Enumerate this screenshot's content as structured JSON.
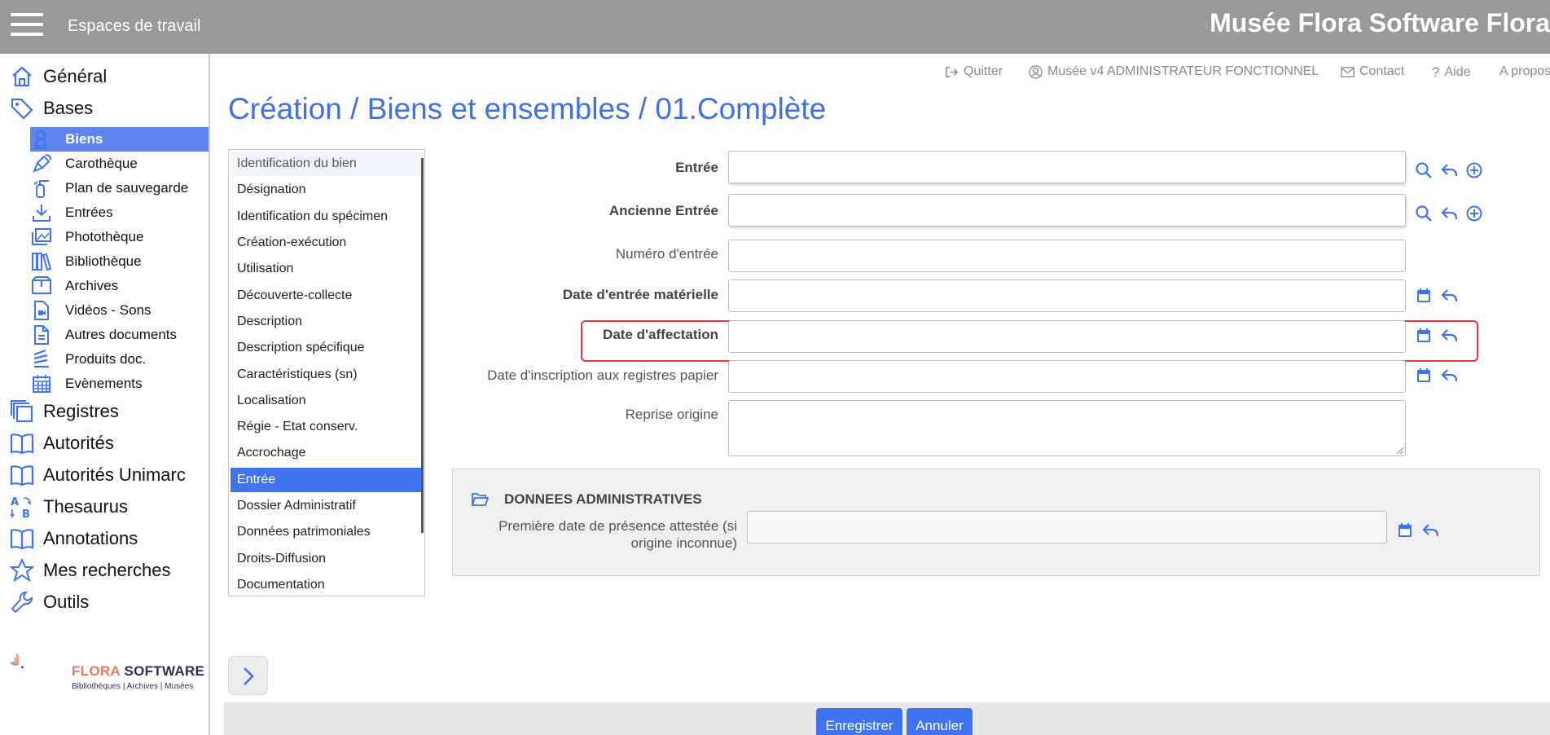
{
  "header": {
    "menu_icon": "hamburger-icon",
    "workspace_label": "Espaces de travail",
    "app_title": "Musée Flora Software Flora"
  },
  "utility_links": [
    {
      "icon": "logout-icon",
      "label": "Quitter"
    },
    {
      "icon": "user-icon",
      "label": "Musée v4 ADMINISTRATEUR FONCTIONNEL"
    },
    {
      "icon": "mail-icon",
      "label": "Contact"
    },
    {
      "icon": "question-icon",
      "label": "Aide"
    },
    {
      "icon": "",
      "label": "A propos"
    }
  ],
  "sidebar": {
    "top_general": {
      "label": "Général",
      "icon": "home-icon"
    },
    "top_bases": {
      "label": "Bases",
      "icon": "tag-icon"
    },
    "bases_items": [
      {
        "label": "Biens",
        "icon": "statue-icon",
        "active": true
      },
      {
        "label": "Carothèque",
        "icon": "pen-icon"
      },
      {
        "label": "Plan de sauvegarde",
        "icon": "extinguisher-icon"
      },
      {
        "label": "Entrées",
        "icon": "download-icon"
      },
      {
        "label": "Photothèque",
        "icon": "images-icon"
      },
      {
        "label": "Bibliothèque",
        "icon": "books-icon"
      },
      {
        "label": "Archives",
        "icon": "box-icon"
      },
      {
        "label": "Vidéos - Sons",
        "icon": "video-file-icon"
      },
      {
        "label": "Autres documents",
        "icon": "document-icon"
      },
      {
        "label": "Produits doc.",
        "icon": "stack-icon"
      },
      {
        "label": "Evènements",
        "icon": "calendar-icon"
      }
    ],
    "bottom_items": [
      {
        "label": "Registres",
        "icon": "registers-icon"
      },
      {
        "label": "Autorités",
        "icon": "book-open-icon"
      },
      {
        "label": "Autorités Unimarc",
        "icon": "book-open-icon"
      },
      {
        "label": "Thesaurus",
        "icon": "thesaurus-icon"
      },
      {
        "label": "Annotations",
        "icon": "book-open-icon"
      },
      {
        "label": "Mes recherches",
        "icon": "star-icon"
      },
      {
        "label": "Outils",
        "icon": "wrench-icon"
      }
    ],
    "logo": {
      "name_part1": "FLORA",
      "name_part2": "SOFTWARE",
      "tagline": "Bibliothèques | Archives | Musées"
    }
  },
  "page_title": "Création / Biens et ensembles / 01.Complète",
  "sections": [
    "Identification du bien",
    "Désignation",
    "Identification du spécimen",
    "Création-exécution",
    "Utilisation",
    "Découverte-collecte",
    "Description",
    "Description spécifique",
    "Caractéristiques (sn)",
    "Localisation",
    "Régie - Etat conserv.",
    "Accrochage",
    "Entrée",
    "Dossier Administratif",
    "Données patrimoniales",
    "Droits-Diffusion",
    "Documentation"
  ],
  "active_section": "Entrée",
  "form": {
    "entree": {
      "label": "Entrée",
      "value": ""
    },
    "ancienne_entree": {
      "label": "Ancienne Entrée",
      "value": ""
    },
    "numero_entree": {
      "label": "Numéro d'entrée",
      "value": ""
    },
    "date_entree_materielle": {
      "label": "Date d'entrée matérielle",
      "value": ""
    },
    "date_affectation": {
      "label": "Date d'affectation",
      "value": ""
    },
    "date_inscription": {
      "label": "Date d'inscription aux registres papier",
      "value": ""
    },
    "reprise_origine": {
      "label": "Reprise origine",
      "value": ""
    }
  },
  "admin": {
    "title": "DONNEES ADMINISTRATIVES",
    "folder_icon": "folder-open-icon",
    "field_label_line1": "Première date de présence attestée (si",
    "field_label_line2": "origine inconnue)",
    "field_value": ""
  },
  "buttons": {
    "save": "Enregistrer",
    "cancel": "Annuler"
  },
  "colors": {
    "accent": "#3f74ee",
    "title": "#3f72dd",
    "header": "#999999",
    "highlight": "#e23b3b"
  }
}
